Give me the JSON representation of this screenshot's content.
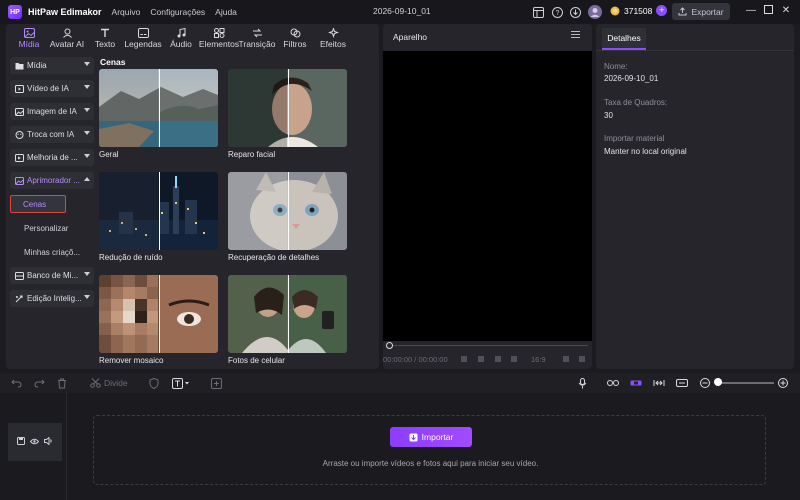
{
  "titlebar": {
    "app_name": "HitPaw Edimakor",
    "menus": [
      "Arquivo",
      "Configurações",
      "Ajuda"
    ],
    "project_title": "2026-09-10_01",
    "coins": "371508",
    "export_label": "Exportar"
  },
  "toolbar": {
    "tools": [
      {
        "label": "Mídia",
        "icon": "media-icon"
      },
      {
        "label": "Avatar AI",
        "icon": "avatar-icon"
      },
      {
        "label": "Texto",
        "icon": "text-icon"
      },
      {
        "label": "Legendas",
        "icon": "subtitles-icon"
      },
      {
        "label": "Áudio",
        "icon": "audio-icon"
      },
      {
        "label": "Elementos",
        "icon": "elements-icon"
      },
      {
        "label": "Transição",
        "icon": "transition-icon"
      },
      {
        "label": "Filtros",
        "icon": "filters-icon"
      },
      {
        "label": "Efeitos",
        "icon": "effects-icon"
      }
    ]
  },
  "sidebar": {
    "items": [
      {
        "label": "Mídia"
      },
      {
        "label": "Vídeo de IA"
      },
      {
        "label": "Imagem de IA"
      },
      {
        "label": "Troca com IA"
      },
      {
        "label": "Melhoria de ..."
      },
      {
        "label": "Aprimorador ..."
      }
    ],
    "subitems": [
      "Cenas",
      "Personalizar",
      "Minhas criaçõ..."
    ],
    "after_items": [
      {
        "label": "Banco de Mi..."
      },
      {
        "label": "Edição Intelig..."
      }
    ]
  },
  "media": {
    "section_title": "Cenas",
    "thumbnails": [
      {
        "label": "Geral"
      },
      {
        "label": "Reparo facial"
      },
      {
        "label": "Redução de ruído"
      },
      {
        "label": "Recuperação de detalhes"
      },
      {
        "label": "Remover mosaico"
      },
      {
        "label": "Fotos de celular"
      }
    ]
  },
  "player": {
    "label": "Aparelho",
    "timecode": "00:00:00 / 00:00:00",
    "aspect": "16:9"
  },
  "details": {
    "tab": "Detalhes",
    "name_label": "Nome:",
    "name_value": "2026-09-10_01",
    "fps_label": "Taxa de Quadros:",
    "fps_value": "30",
    "import_label": "Importar material",
    "import_value": "Manter no local original"
  },
  "timeline": {
    "split_label": "Divide",
    "import_button": "Importar",
    "hint": "Arraste ou importe vídeos e fotos aqui para iniciar seu vídeo."
  },
  "colors": {
    "accent": "#8b4dff",
    "selected_outline": "#e0443e"
  }
}
